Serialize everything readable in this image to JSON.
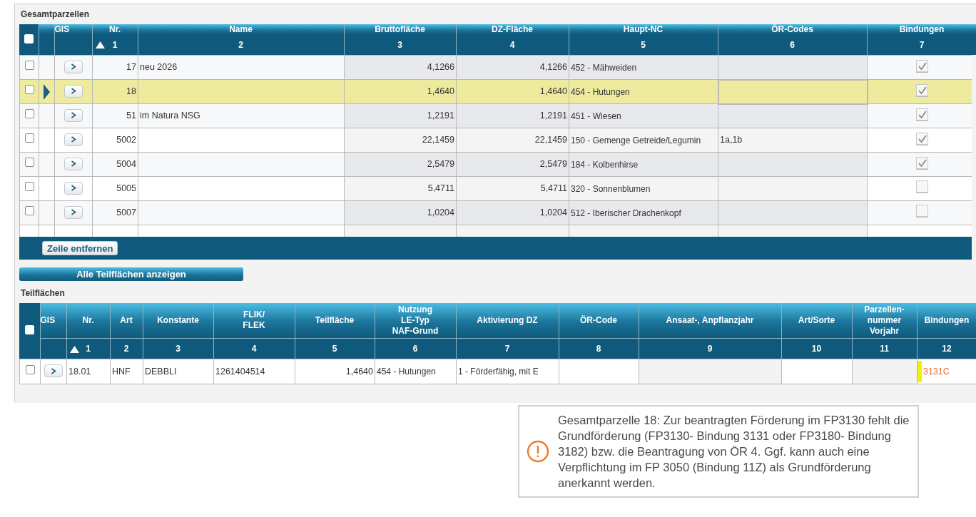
{
  "section_title": "Gesamtparzellen",
  "parcels": {
    "select_all_checked": false,
    "columns": [
      {
        "label": "GIS"
      },
      {
        "label": "Nr.",
        "number": "1",
        "sorted_ascending": true
      },
      {
        "label": "Name",
        "number": "2"
      },
      {
        "label": "Bruttofläche",
        "number": "3"
      },
      {
        "label": "DZ-Fläche",
        "number": "4"
      },
      {
        "label": "Haupt-NC",
        "number": "5"
      },
      {
        "label": "ÖR-Codes",
        "number": "6"
      },
      {
        "label": "Bindungen",
        "number": "7"
      }
    ],
    "rows": [
      {
        "checked": false,
        "selected": false,
        "nr": "17",
        "name": "neu 2026",
        "brutto": "4,1266",
        "dz": "4,1266",
        "haupt_nc": "452 - Mähweiden",
        "bindungen": true
      },
      {
        "checked": false,
        "selected": true,
        "nr": "18",
        "brutto": "1,4640",
        "dz": "1,4640",
        "haupt_nc": "454 - Hutungen",
        "bindungen": true
      },
      {
        "checked": false,
        "selected": false,
        "nr": "51",
        "name": "im Natura NSG",
        "brutto": "1,2191",
        "dz": "1,2191",
        "haupt_nc": "451 - Wiesen",
        "bindungen": true
      },
      {
        "checked": false,
        "selected": false,
        "nr": "5002",
        "brutto": "22,1459",
        "dz": "22,1459",
        "haupt_nc": "150 - Gemenge Getreide/Legumin",
        "oer_codes": "1a,1b",
        "bindungen": true
      },
      {
        "checked": false,
        "selected": false,
        "nr": "5004",
        "brutto": "2,5479",
        "dz": "2,5479",
        "haupt_nc": "184 - Kolbenhirse",
        "bindungen": true
      },
      {
        "checked": false,
        "selected": false,
        "nr": "5005",
        "brutto": "5,4711",
        "dz": "5,4711",
        "haupt_nc": "320 - Sonnenblumen",
        "bindungen": false
      },
      {
        "checked": false,
        "selected": false,
        "nr": "5007",
        "brutto": "1,0204",
        "dz": "1,0204",
        "haupt_nc": "512 - Iberischer Drachenkopf",
        "bindungen": false
      }
    ],
    "remove_button": "Zeile entfernen"
  },
  "show_all_button": "Alle Teilflächen anzeigen",
  "subsection_title": "Teilflächen",
  "subplots": {
    "select_all_checked": false,
    "columns": [
      {
        "label": "GIS"
      },
      {
        "label": "Nr.",
        "number": "1",
        "sorted_ascending": true
      },
      {
        "label": "Art",
        "number": "2"
      },
      {
        "label": "Konstante",
        "number": "3"
      },
      {
        "label": "FLIK/\nFLEK",
        "number": "4"
      },
      {
        "label": "Teilfläche",
        "number": "5"
      },
      {
        "label": "Nutzung\nLE-Typ\nNAF-Grund",
        "number": "6"
      },
      {
        "label": "Aktivierung DZ",
        "number": "7"
      },
      {
        "label": "ÖR-Code",
        "number": "8"
      },
      {
        "label": "Ansaat-, Anpflanzjahr",
        "number": "9"
      },
      {
        "label": "Art/Sorte",
        "number": "10"
      },
      {
        "label": "Parzellen-\nnummer\nVorjahr",
        "number": "11"
      },
      {
        "label": "Bindungen",
        "number": "12"
      }
    ],
    "rows": [
      {
        "checked": false,
        "nr": "18.01",
        "art": "HNF",
        "konstante": "DEBBLI",
        "flik": "1261404514",
        "teilflaeche": "1,4640",
        "nutzung": "454 - Hutungen",
        "aktivierung": "1 - Förderfähig, mit E",
        "bindungen": "3131C",
        "warning": true
      }
    ]
  },
  "message": {
    "kind": "warning",
    "text": "Gesamtparzelle 18: Zur beantragten Förderung im FP3130 fehlt die Grundförderung (FP3130- Bindung 3131 oder FP3180- Bindung 3182) bzw. die Beantragung von ÖR 4. Ggf. kann auch eine Verpflichtung im FP 3050 (Bindung 11Z) als Grundförderung anerkannt werden."
  }
}
